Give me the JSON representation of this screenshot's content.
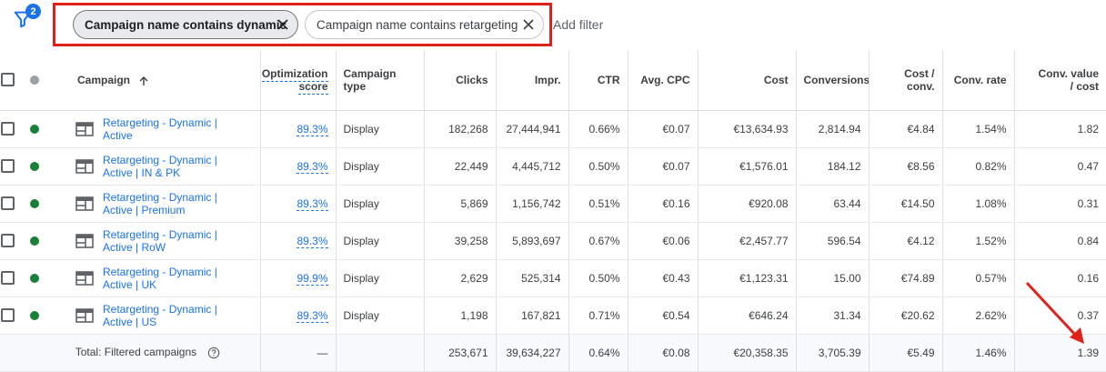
{
  "filters": {
    "badge_count": "2",
    "chips": [
      {
        "label": "Campaign name contains dynamic",
        "active": true
      },
      {
        "label": "Campaign name contains retargeting",
        "active": false
      }
    ],
    "add_filter": "Add filter"
  },
  "columns": {
    "campaign": "Campaign",
    "opt_score_line1": "Optimization",
    "opt_score_line2": "score",
    "campaign_type_line1": "Campaign",
    "campaign_type_line2": "type",
    "clicks": "Clicks",
    "impr": "Impr.",
    "ctr": "CTR",
    "avg_cpc": "Avg. CPC",
    "cost": "Cost",
    "conversions": "Conversions",
    "cost_conv_line1": "Cost /",
    "cost_conv_line2": "conv.",
    "conv_rate": "Conv. rate",
    "conv_value_line1": "Conv. value",
    "conv_value_line2": "/ cost"
  },
  "rows": [
    {
      "name_line1": "Retargeting - Dynamic |",
      "name_line2": "Active",
      "opt": "89.3%",
      "type": "Display",
      "clicks": "182,268",
      "impr": "27,444,941",
      "ctr": "0.66%",
      "cpc": "€0.07",
      "cost": "€13,634.93",
      "conv": "2,814.94",
      "cost_conv": "€4.84",
      "conv_rate": "1.54%",
      "conv_value": "1.82"
    },
    {
      "name_line1": "Retargeting - Dynamic |",
      "name_line2": "Active | IN & PK",
      "opt": "89.3%",
      "type": "Display",
      "clicks": "22,449",
      "impr": "4,445,712",
      "ctr": "0.50%",
      "cpc": "€0.07",
      "cost": "€1,576.01",
      "conv": "184.12",
      "cost_conv": "€8.56",
      "conv_rate": "0.82%",
      "conv_value": "0.47"
    },
    {
      "name_line1": "Retargeting - Dynamic |",
      "name_line2": "Active | Premium",
      "opt": "89.3%",
      "type": "Display",
      "clicks": "5,869",
      "impr": "1,156,742",
      "ctr": "0.51%",
      "cpc": "€0.16",
      "cost": "€920.08",
      "conv": "63.44",
      "cost_conv": "€14.50",
      "conv_rate": "1.08%",
      "conv_value": "0.31"
    },
    {
      "name_line1": "Retargeting - Dynamic |",
      "name_line2": "Active | RoW",
      "opt": "89.3%",
      "type": "Display",
      "clicks": "39,258",
      "impr": "5,893,697",
      "ctr": "0.67%",
      "cpc": "€0.06",
      "cost": "€2,457.77",
      "conv": "596.54",
      "cost_conv": "€4.12",
      "conv_rate": "1.52%",
      "conv_value": "0.84"
    },
    {
      "name_line1": "Retargeting - Dynamic |",
      "name_line2": "Active | UK",
      "opt": "99.9%",
      "type": "Display",
      "clicks": "2,629",
      "impr": "525,314",
      "ctr": "0.50%",
      "cpc": "€0.43",
      "cost": "€1,123.31",
      "conv": "15.00",
      "cost_conv": "€74.89",
      "conv_rate": "0.57%",
      "conv_value": "0.16"
    },
    {
      "name_line1": "Retargeting - Dynamic |",
      "name_line2": "Active | US",
      "opt": "89.3%",
      "type": "Display",
      "clicks": "1,198",
      "impr": "167,821",
      "ctr": "0.71%",
      "cpc": "€0.54",
      "cost": "€646.24",
      "conv": "31.34",
      "cost_conv": "€20.62",
      "conv_rate": "2.62%",
      "conv_value": "0.37"
    }
  ],
  "total": {
    "label": "Total: Filtered campaigns",
    "opt": "—",
    "clicks": "253,671",
    "impr": "39,634,227",
    "ctr": "0.64%",
    "cpc": "€0.08",
    "cost": "€20,358.35",
    "conv": "3,705.39",
    "cost_conv": "€5.49",
    "conv_rate": "1.46%",
    "conv_value": "1.39"
  },
  "colors": {
    "accent": "#1a73e8",
    "highlight": "#e0201b",
    "status_enabled": "#188038"
  },
  "icons": [
    "filter-icon",
    "close-icon",
    "sort-arrow-up-icon",
    "display-campaign-icon",
    "help-icon",
    "annotation-arrow"
  ]
}
